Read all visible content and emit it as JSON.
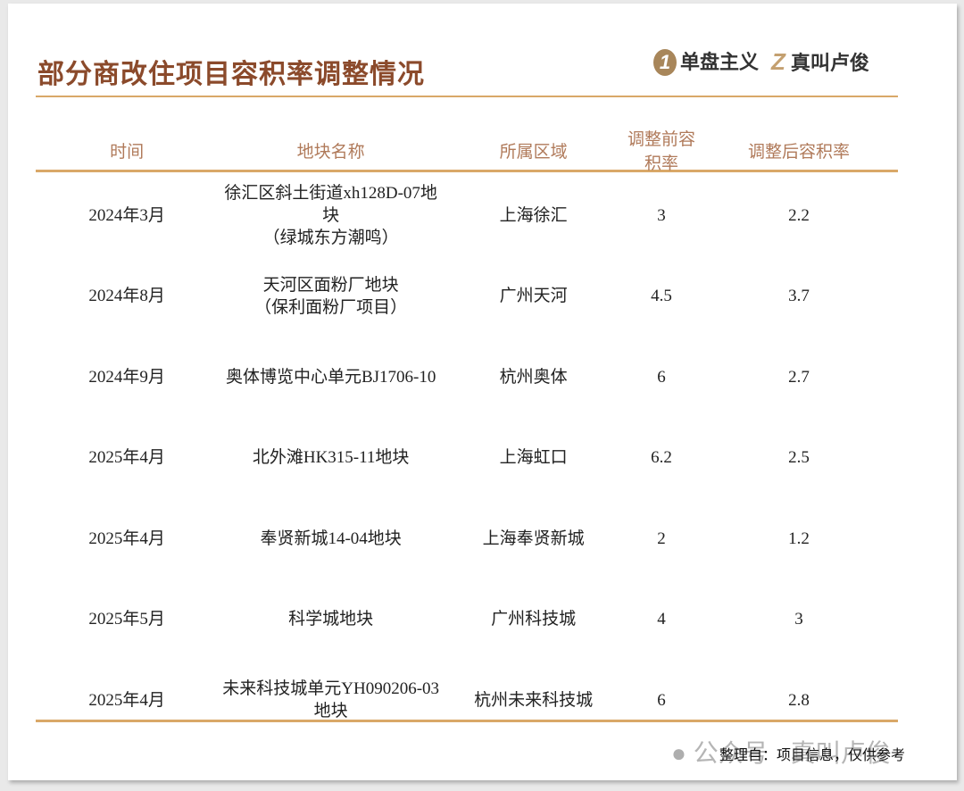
{
  "title": "部分商改住项目容积率调整情况",
  "logos": {
    "logo1_mark": "1",
    "logo1": "单盘主义",
    "logo2_mark": "Z",
    "logo2": "真叫卢俊"
  },
  "headers": [
    "时间",
    "地块名称",
    "所属区域",
    "调整前容积率",
    "调整后容积率"
  ],
  "rows": [
    {
      "time": "2024年3月",
      "name": "徐汇区斜土街道xh128D-07地块",
      "name2": "（绿城东方潮鸣）",
      "region": "上海徐汇",
      "before": "3",
      "after": "2.2"
    },
    {
      "time": "2024年8月",
      "name": "天河区面粉厂地块",
      "name2": "（保利面粉厂项目）",
      "region": "广州天河",
      "before": "4.5",
      "after": "3.7"
    },
    {
      "time": "2024年9月",
      "name": "奥体博览中心单元BJ1706-10",
      "name2": "",
      "region": "杭州奥体",
      "before": "6",
      "after": "2.7"
    },
    {
      "time": "2025年4月",
      "name": "北外滩HK315-11地块",
      "name2": "",
      "region": "上海虹口",
      "before": "6.2",
      "after": "2.5"
    },
    {
      "time": "2025年4月",
      "name": "奉贤新城14-04地块",
      "name2": "",
      "region": "上海奉贤新城",
      "before": "2",
      "after": "1.2"
    },
    {
      "time": "2025年5月",
      "name": "科学城地块",
      "name2": "",
      "region": "广州科技城",
      "before": "4",
      "after": "3"
    },
    {
      "time": "2025年4月",
      "name": "未来科技城单元YH090206-03地块",
      "name2": "",
      "region": "杭州未来科技城",
      "before": "6",
      "after": "2.8"
    }
  ],
  "footer": "整理自：项目信息，仅供参考",
  "watermark": "公众号 · 真叫卢俊"
}
